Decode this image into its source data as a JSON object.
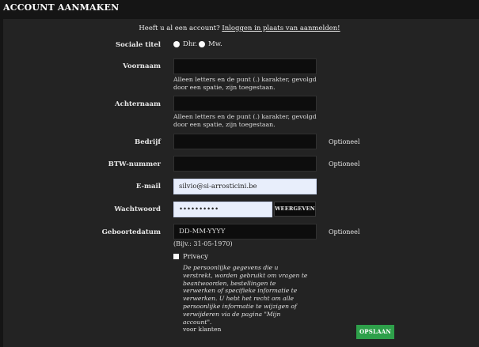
{
  "page": {
    "title": "ACCOUNT AANMAKEN"
  },
  "login": {
    "question": "Heeft u al een account?",
    "link": "Inloggen in plaats van aanmelden!"
  },
  "form": {
    "social_title": {
      "label": "Sociale titel",
      "options": [
        "Dhr.",
        "Mw."
      ]
    },
    "firstname": {
      "label": "Voornaam",
      "value": "",
      "help": "Alleen letters en de punt (.) karakter, gevolgd door een spatie, zijn toegestaan."
    },
    "lastname": {
      "label": "Achternaam",
      "value": "",
      "help": "Alleen letters en de punt (.) karakter, gevolgd door een spatie, zijn toegestaan."
    },
    "company": {
      "label": "Bedrijf",
      "value": "",
      "optional": "Optioneel"
    },
    "vat": {
      "label": "BTW-nummer",
      "value": "",
      "optional": "Optioneel"
    },
    "email": {
      "label": "E-mail",
      "value": "silvio@si-arrosticini.be"
    },
    "password": {
      "label": "Wachtwoord",
      "value": "••••••••••",
      "show_label": "WEERGEVEN"
    },
    "birthdate": {
      "label": "Geboortedatum",
      "placeholder": "DD-MM-YYYY",
      "hint": "(Bijv.: 31-05-1970)",
      "optional": "Optioneel"
    },
    "privacy": {
      "label": "Privacy",
      "text_italic": "De persoonlijke gegevens die u verstrekt, worden gebruikt om vragen te beantwoorden, bestellingen te verwerken of specifieke informatie te verwerken. U hebt het recht om alle persoonlijke informatie te wijzigen of verwijderen via de pagina \"Mijn account\".",
      "text_plain": "voor klanten"
    },
    "save_label": "OPSLAAN"
  }
}
